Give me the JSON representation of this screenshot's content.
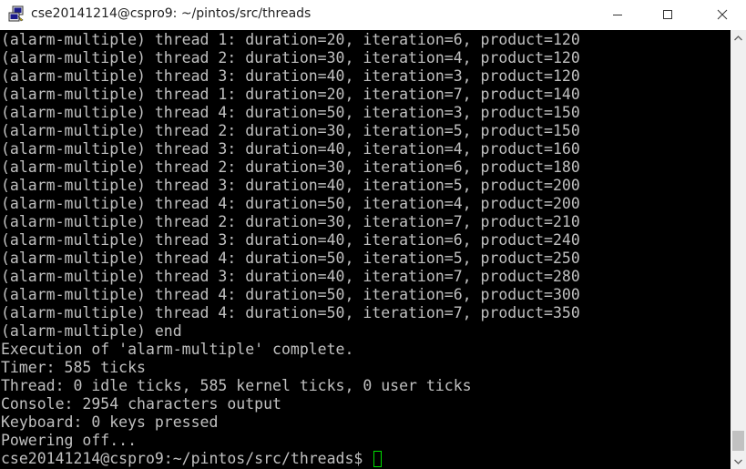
{
  "window": {
    "title": "cse20141214@cspro9: ~/pintos/src/threads",
    "app_icon": "putty-icon",
    "controls": [
      "minimize-icon",
      "maximize-icon",
      "close-icon"
    ]
  },
  "terminal": {
    "text_color": "#c0c0c0",
    "background": "#000000",
    "cursor_color": "#00e000",
    "lines": [
      "(alarm-multiple) thread 1: duration=20, iteration=6, product=120",
      "(alarm-multiple) thread 2: duration=30, iteration=4, product=120",
      "(alarm-multiple) thread 3: duration=40, iteration=3, product=120",
      "(alarm-multiple) thread 1: duration=20, iteration=7, product=140",
      "(alarm-multiple) thread 4: duration=50, iteration=3, product=150",
      "(alarm-multiple) thread 2: duration=30, iteration=5, product=150",
      "(alarm-multiple) thread 3: duration=40, iteration=4, product=160",
      "(alarm-multiple) thread 2: duration=30, iteration=6, product=180",
      "(alarm-multiple) thread 3: duration=40, iteration=5, product=200",
      "(alarm-multiple) thread 4: duration=50, iteration=4, product=200",
      "(alarm-multiple) thread 2: duration=30, iteration=7, product=210",
      "(alarm-multiple) thread 3: duration=40, iteration=6, product=240",
      "(alarm-multiple) thread 4: duration=50, iteration=5, product=250",
      "(alarm-multiple) thread 3: duration=40, iteration=7, product=280",
      "(alarm-multiple) thread 4: duration=50, iteration=6, product=300",
      "(alarm-multiple) thread 4: duration=50, iteration=7, product=350",
      "(alarm-multiple) end",
      "Execution of 'alarm-multiple' complete.",
      "Timer: 585 ticks",
      "Thread: 0 idle ticks, 585 kernel ticks, 0 user ticks",
      "Console: 2954 characters output",
      "Keyboard: 0 keys pressed",
      "Powering off..."
    ],
    "prompt": "cse20141214@cspro9:~/pintos/src/threads$ "
  }
}
